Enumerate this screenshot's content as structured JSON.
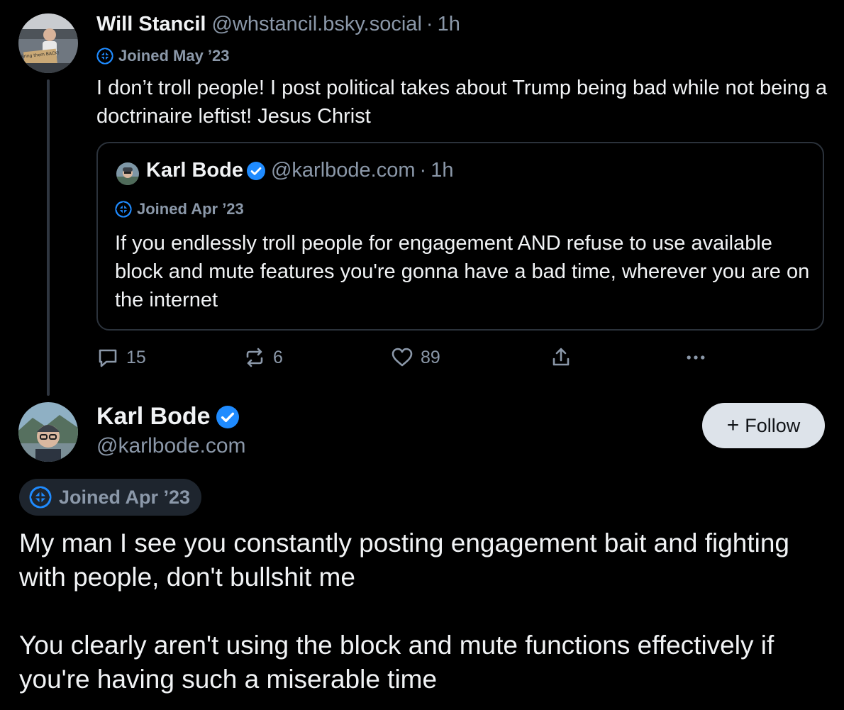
{
  "parent_post": {
    "author_name": "Will Stancil",
    "handle": "@whstancil.bsky.social",
    "separator": "·",
    "time": "1h",
    "joined": "Joined May ’23",
    "avatar_sign_text": "Bring them BACK!",
    "text": "I don’t troll people! I post political takes about Trump being bad while not being a doctrinaire leftist! Jesus Christ",
    "quote": {
      "author_name": "Karl Bode",
      "handle": "@karlbode.com",
      "separator": "·",
      "time": "1h",
      "joined": "Joined Apr ’23",
      "text": "If you endlessly troll people for engagement AND refuse to use available block and mute features you're gonna have a bad time, wherever you are on the internet"
    },
    "actions": {
      "reply_count": "15",
      "repost_count": "6",
      "like_count": "89"
    }
  },
  "main_post": {
    "author_name": "Karl Bode",
    "handle": "@karlbode.com",
    "follow_label": "Follow",
    "follow_plus": "+",
    "joined": "Joined Apr ’23",
    "paragraph_1": "My man I see you constantly posting engagement bait and fighting with people, don't bullshit me",
    "paragraph_2": "You clearly aren't using the block and mute functions effectively if you're having such a miserable time"
  },
  "colors": {
    "background": "#000000",
    "text": "#f1f3f5",
    "muted": "#8b98a9",
    "verified": "#1f8bff",
    "follow_button_bg": "#dde3ea",
    "joined_pill_bg": "#1e252e",
    "border": "#2b323b"
  }
}
